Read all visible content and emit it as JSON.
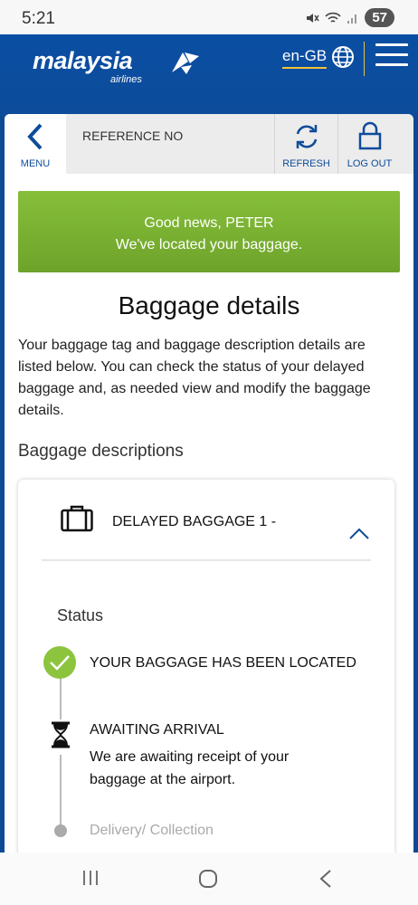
{
  "status_bar": {
    "time": "5:21",
    "battery": "57"
  },
  "header": {
    "brand": "malaysia",
    "brand_sub": "airlines",
    "language": "en-GB"
  },
  "nav": {
    "menu_label": "MENU",
    "reference_label": "REFERENCE NO",
    "refresh_label": "REFRESH",
    "logout_label": "LOG OUT"
  },
  "banner": {
    "line1": "Good news, PETER",
    "line2": "We've located your baggage."
  },
  "page": {
    "title": "Baggage details",
    "intro": "Your baggage tag and baggage description details are listed below. You can check the status of your delayed baggage and, as needed view and modify the baggage details.",
    "descriptions_heading": "Baggage descriptions"
  },
  "baggage": {
    "title": "DELAYED BAGGAGE 1 -",
    "status_heading": "Status",
    "steps": [
      {
        "title": "YOUR BAGGAGE HAS BEEN LOCATED",
        "state": "done"
      },
      {
        "title": "AWAITING ARRIVAL",
        "description": "We are awaiting receipt of your baggage at the airport.",
        "state": "current"
      },
      {
        "title": "Delivery/ Collection",
        "state": "pending"
      }
    ]
  },
  "colors": {
    "brand_blue": "#0d4c9a",
    "success_green": "#7ab232",
    "accent_gold": "#f2c23a"
  }
}
